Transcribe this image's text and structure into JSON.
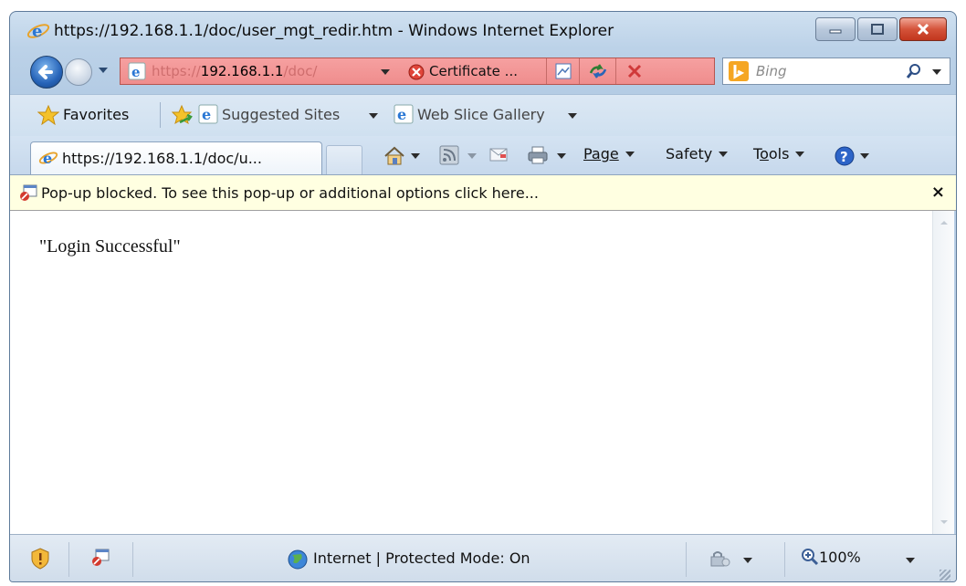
{
  "window": {
    "title": "https://192.168.1.1/doc/user_mgt_redir.htm - Windows Internet Explorer"
  },
  "navigation": {
    "address_prefix": "https://",
    "address_host": "192.168.1.1",
    "address_suffix": "/doc/",
    "certificate_label": "Certificate ...",
    "search_placeholder": "Bing"
  },
  "favorites_bar": {
    "favorites_label": "Favorites",
    "items": [
      "Suggested Sites",
      "Web Slice Gallery"
    ]
  },
  "tab": {
    "title": "https://192.168.1.1/doc/u..."
  },
  "command_bar": {
    "page_label": "Page",
    "safety_label": "Safety",
    "tools_label_pre": "T",
    "tools_label_u": "o",
    "tools_label_post": "ols"
  },
  "infobar": {
    "text": "Pop-up blocked. To see this pop-up or additional options click here...",
    "close": "×"
  },
  "content": {
    "text": "\"Login Successful\""
  },
  "status_bar": {
    "zone": "Internet | Protected Mode: On",
    "zoom": "100%"
  },
  "colors": {
    "address_error_bg": "#ef8d8d",
    "infobar_bg": "#ffffe1",
    "chrome_blue": "#bcd2e8"
  }
}
